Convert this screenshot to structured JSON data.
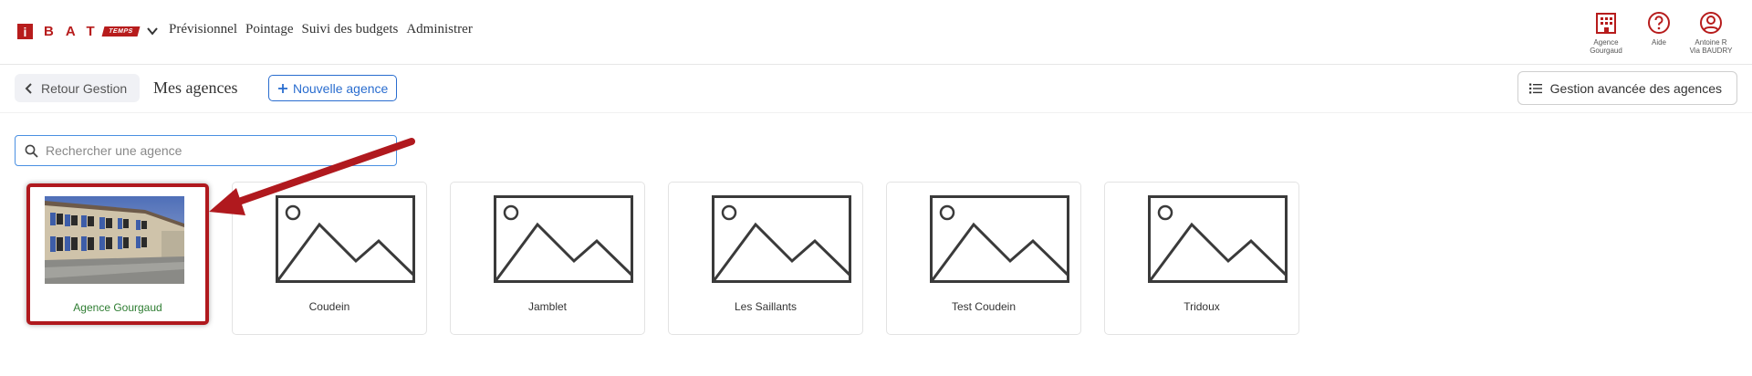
{
  "brand": {
    "logo_initial": "i",
    "logo_letters": "BAT",
    "logo_tag": "TEMPS",
    "accent": "#b71c1c"
  },
  "nav": {
    "items": [
      "Prévisionnel",
      "Pointage",
      "Suivi des budgets",
      "Administrer"
    ]
  },
  "top_right": {
    "agency_label_1": "Agence",
    "agency_label_2": "Gourgaud",
    "help_label": "Aide",
    "user_label_1": "Antoine R",
    "user_label_2": "Via BAUDRY"
  },
  "header": {
    "back_label": "Retour Gestion",
    "title": "Mes agences",
    "new_agency_label": "Nouvelle agence",
    "advanced_label": "Gestion avancée des agences"
  },
  "search": {
    "placeholder": "Rechercher une agence",
    "value": ""
  },
  "agencies": [
    {
      "name": "Agence Gourgaud",
      "has_photo": true,
      "selected": true
    },
    {
      "name": "Coudein",
      "has_photo": false,
      "selected": false
    },
    {
      "name": "Jamblet",
      "has_photo": false,
      "selected": false
    },
    {
      "name": "Les Saillants",
      "has_photo": false,
      "selected": false
    },
    {
      "name": "Test Coudein",
      "has_photo": false,
      "selected": false
    },
    {
      "name": "Tridoux",
      "has_photo": false,
      "selected": false
    }
  ],
  "colors": {
    "primary_blue": "#2a6dcf",
    "highlight_red": "#b0191e",
    "selected_name_green": "#2e7d32"
  }
}
